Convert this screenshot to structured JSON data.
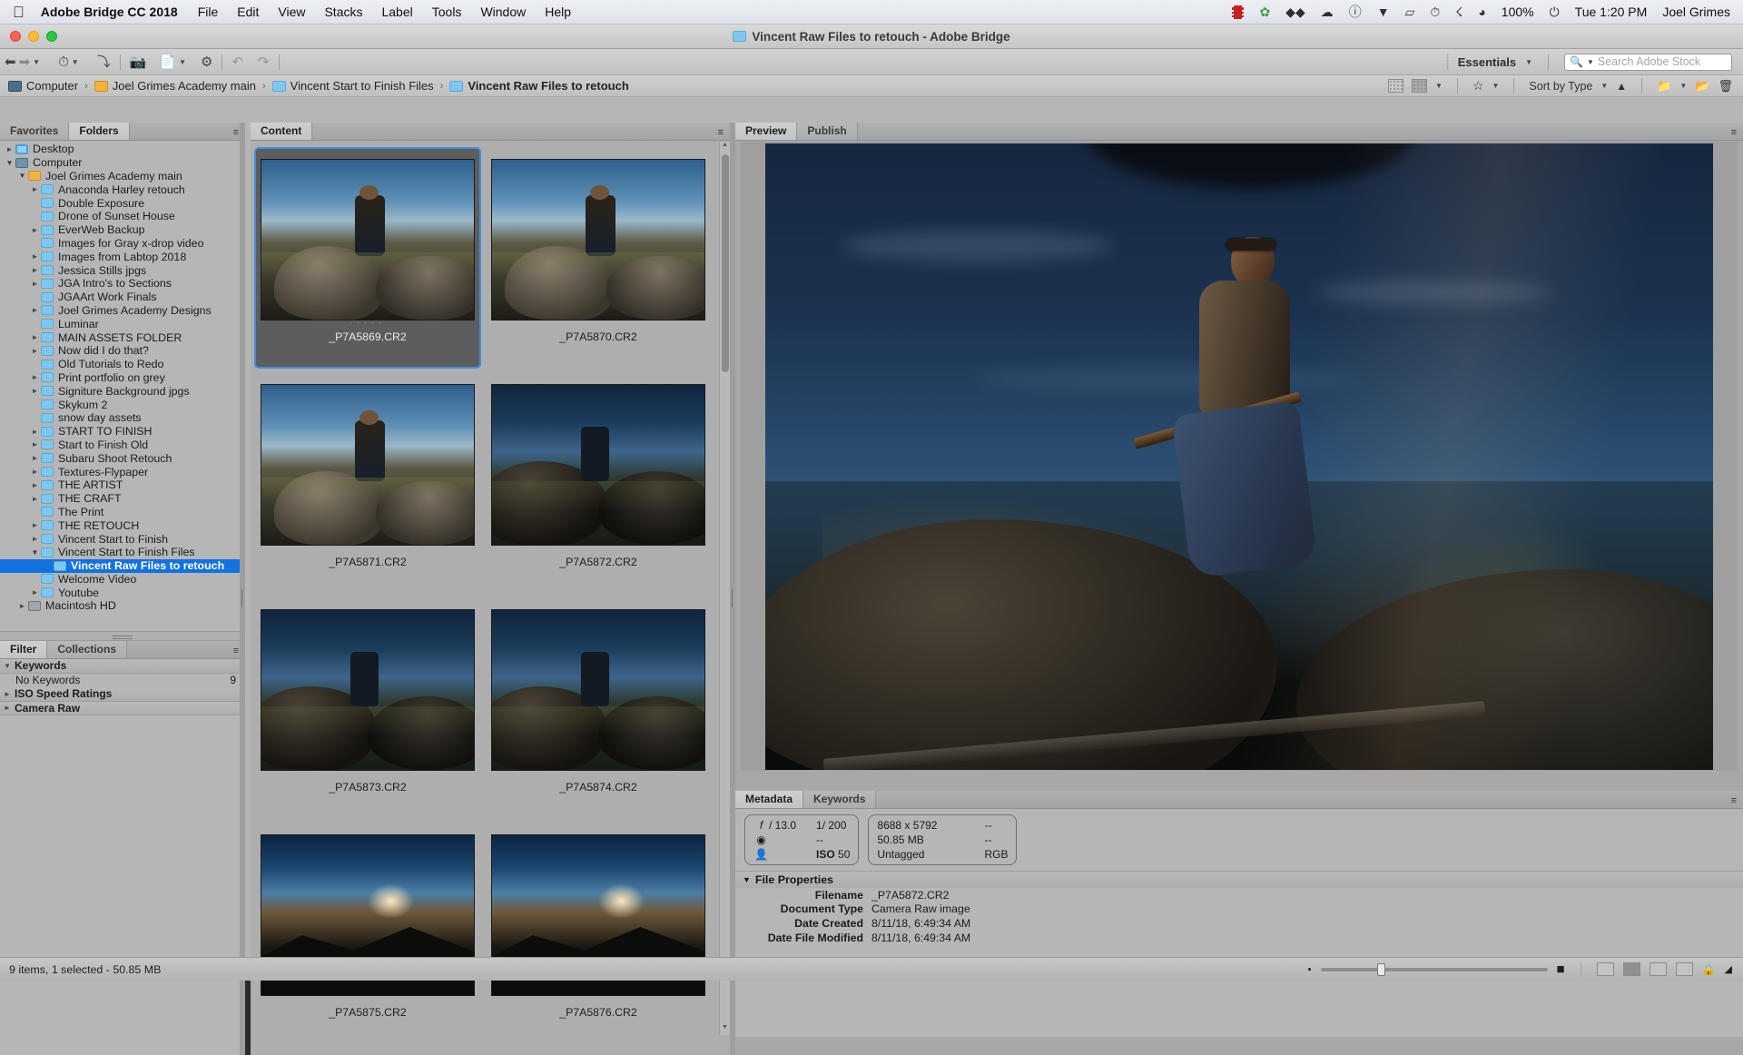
{
  "menubar": {
    "apple_icon": "apple-icon",
    "app_name": "Adobe Bridge CC 2018",
    "items": [
      "File",
      "Edit",
      "View",
      "Stacks",
      "Label",
      "Tools",
      "Window",
      "Help"
    ],
    "status_icons": [
      "filmstrip-icon",
      "leaf-icon",
      "dropbox-icon",
      "creative-cloud-icon",
      "info-icon",
      "airdrop-icon",
      "airplay-icon",
      "timemachine-icon",
      "bluetooth-icon",
      "wifi-icon"
    ],
    "battery_percent": "100%",
    "battery_icon": "battery-charging-icon",
    "clock": "Tue 1:20 PM",
    "user": "Joel Grimes"
  },
  "window": {
    "title": "Vincent Raw Files to retouch - Adobe Bridge",
    "title_icon": "folder-icon"
  },
  "toolbar": {
    "back_icon": "arrow-left-icon",
    "forward_icon": "arrow-right-icon",
    "history_dropdown_icon": "chevron-down-icon",
    "recent_icon": "clock-icon",
    "parent_icon": "go-up-icon",
    "boomerang_icon": "reveal-icon",
    "camera_import_icon": "get-photos-from-camera-icon",
    "refine_icon": "refine-icon",
    "rotate_icon": "rotate-icon",
    "rotate_ccw_icon": "rotate-counter-clockwise-icon",
    "rotate_cw_icon": "rotate-clockwise-icon",
    "workspace": "Essentials",
    "workspace_caret_icon": "chevron-down-icon",
    "search_placeholder": "Search Adobe Stock",
    "search_value": "",
    "search_icon": "search-icon"
  },
  "breadcrumb": {
    "separator": "›",
    "items": [
      {
        "label": "Computer",
        "icon": "computer-icon",
        "current": false
      },
      {
        "label": "Joel Grimes Academy main",
        "icon": "drive-icon",
        "current": false
      },
      {
        "label": "Vincent Start to Finish Files",
        "icon": "folder-icon",
        "current": false
      },
      {
        "label": "Vincent Raw Files to retouch",
        "icon": "folder-icon",
        "current": true
      }
    ],
    "right_tools": {
      "thumbnail_view_icon": "thumbnail-view-icon",
      "filter_view_icon": "filter-view-icon",
      "view_caret_icon": "chevron-down-icon",
      "star_icon": "star-rating-icon",
      "star_caret_icon": "chevron-down-icon",
      "sort_label": "Sort by Type",
      "sort_caret_icon": "chevron-down-icon",
      "sort_direction_icon": "sort-ascending-icon",
      "open_folder_icon": "open-in-icon",
      "open_caret_icon": "chevron-down-icon",
      "new_folder_icon": "new-folder-icon",
      "delete_icon": "trash-icon"
    }
  },
  "left_panel": {
    "tabs": [
      {
        "label": "Favorites",
        "active": false
      },
      {
        "label": "Folders",
        "active": true
      }
    ],
    "menu_icon": "panel-menu-icon",
    "tree": [
      {
        "label": "Desktop",
        "depth": 0,
        "twisty": "collapsed",
        "icon": "folder-icon",
        "selected": false
      },
      {
        "label": "Computer",
        "depth": 0,
        "twisty": "expanded",
        "icon": "computer-icon",
        "selected": false
      },
      {
        "label": "Joel Grimes Academy main",
        "depth": 1,
        "twisty": "expanded",
        "icon": "drive-icon",
        "selected": false
      },
      {
        "label": "Anaconda Harley retouch",
        "depth": 2,
        "twisty": "collapsed",
        "icon": "folder-icon",
        "selected": false
      },
      {
        "label": "Double Exposure",
        "depth": 2,
        "twisty": "none",
        "icon": "folder-icon",
        "selected": false
      },
      {
        "label": "Drone of Sunset House",
        "depth": 2,
        "twisty": "none",
        "icon": "folder-icon",
        "selected": false
      },
      {
        "label": "EverWeb Backup",
        "depth": 2,
        "twisty": "collapsed",
        "icon": "folder-icon",
        "selected": false
      },
      {
        "label": "Images for Gray x-drop video",
        "depth": 2,
        "twisty": "none",
        "icon": "folder-icon",
        "selected": false
      },
      {
        "label": "Images from Labtop 2018",
        "depth": 2,
        "twisty": "collapsed",
        "icon": "folder-icon",
        "selected": false
      },
      {
        "label": "Jessica Stills jpgs",
        "depth": 2,
        "twisty": "collapsed",
        "icon": "folder-icon",
        "selected": false
      },
      {
        "label": "JGA Intro's to Sections",
        "depth": 2,
        "twisty": "collapsed",
        "icon": "folder-icon",
        "selected": false
      },
      {
        "label": "JGAArt Work Finals",
        "depth": 2,
        "twisty": "none",
        "icon": "folder-icon",
        "selected": false
      },
      {
        "label": "Joel Grimes Academy Designs",
        "depth": 2,
        "twisty": "collapsed",
        "icon": "folder-icon",
        "selected": false
      },
      {
        "label": "Luminar",
        "depth": 2,
        "twisty": "none",
        "icon": "folder-icon",
        "selected": false
      },
      {
        "label": "MAIN ASSETS FOLDER",
        "depth": 2,
        "twisty": "collapsed",
        "icon": "folder-icon",
        "selected": false
      },
      {
        "label": "Now did I do that?",
        "depth": 2,
        "twisty": "collapsed",
        "icon": "folder-icon",
        "selected": false
      },
      {
        "label": "Old Tutorials to Redo",
        "depth": 2,
        "twisty": "none",
        "icon": "folder-icon",
        "selected": false
      },
      {
        "label": "Print portfolio on grey",
        "depth": 2,
        "twisty": "collapsed",
        "icon": "folder-icon",
        "selected": false
      },
      {
        "label": "Signiture Background jpgs",
        "depth": 2,
        "twisty": "collapsed",
        "icon": "folder-icon",
        "selected": false
      },
      {
        "label": "Skykum 2",
        "depth": 2,
        "twisty": "none",
        "icon": "folder-icon",
        "selected": false
      },
      {
        "label": "snow day assets",
        "depth": 2,
        "twisty": "none",
        "icon": "folder-icon",
        "selected": false
      },
      {
        "label": "START TO FINISH",
        "depth": 2,
        "twisty": "collapsed",
        "icon": "folder-icon",
        "selected": false
      },
      {
        "label": "Start to Finish Old",
        "depth": 2,
        "twisty": "collapsed",
        "icon": "folder-icon",
        "selected": false
      },
      {
        "label": "Subaru Shoot Retouch",
        "depth": 2,
        "twisty": "collapsed",
        "icon": "folder-icon",
        "selected": false
      },
      {
        "label": "Textures-Flypaper",
        "depth": 2,
        "twisty": "collapsed",
        "icon": "folder-icon",
        "selected": false
      },
      {
        "label": "THE ARTIST",
        "depth": 2,
        "twisty": "collapsed",
        "icon": "folder-icon",
        "selected": false
      },
      {
        "label": "THE CRAFT",
        "depth": 2,
        "twisty": "collapsed",
        "icon": "folder-icon",
        "selected": false
      },
      {
        "label": "The Print",
        "depth": 2,
        "twisty": "none",
        "icon": "folder-icon",
        "selected": false
      },
      {
        "label": "THE RETOUCH",
        "depth": 2,
        "twisty": "collapsed",
        "icon": "folder-icon",
        "selected": false
      },
      {
        "label": "Vincent Start to Finish",
        "depth": 2,
        "twisty": "collapsed",
        "icon": "folder-icon",
        "selected": false
      },
      {
        "label": "Vincent Start to Finish Files",
        "depth": 2,
        "twisty": "expanded",
        "icon": "folder-icon",
        "selected": false
      },
      {
        "label": "Vincent Raw Files to retouch",
        "depth": 3,
        "twisty": "none",
        "icon": "folder-icon",
        "selected": true
      },
      {
        "label": "Welcome Video",
        "depth": 2,
        "twisty": "none",
        "icon": "folder-icon",
        "selected": false
      },
      {
        "label": "Youtube",
        "depth": 2,
        "twisty": "collapsed",
        "icon": "folder-icon",
        "selected": false
      },
      {
        "label": "Macintosh HD",
        "depth": 1,
        "twisty": "collapsed",
        "icon": "harddrive-icon",
        "selected": false
      }
    ]
  },
  "filter_panel": {
    "tabs": [
      {
        "label": "Filter",
        "active": true
      },
      {
        "label": "Collections",
        "active": false
      }
    ],
    "menu_icon": "panel-menu-icon",
    "groups": [
      {
        "label": "Keywords",
        "expanded": true,
        "rows": [
          {
            "label": "No Keywords",
            "count": "9"
          }
        ]
      },
      {
        "label": "ISO Speed Ratings",
        "expanded": false,
        "rows": []
      },
      {
        "label": "Camera Raw",
        "expanded": false,
        "rows": []
      }
    ]
  },
  "content_panel": {
    "tabs": [
      {
        "label": "Content",
        "active": true
      }
    ],
    "menu_icon": "panel-menu-icon",
    "items": [
      {
        "name": "_P7A5869.CR2",
        "selected": true,
        "scene": "rocks-day",
        "has_dots": true
      },
      {
        "name": "_P7A5870.CR2",
        "selected": false,
        "scene": "rocks-day",
        "has_dots": false
      },
      {
        "name": "_P7A5871.CR2",
        "selected": false,
        "scene": "rocks-day",
        "has_dots": false
      },
      {
        "name": "_P7A5872.CR2",
        "selected": false,
        "scene": "rocks-dusk",
        "has_dots": false
      },
      {
        "name": "_P7A5873.CR2",
        "selected": false,
        "scene": "rocks-dusk",
        "has_dots": false
      },
      {
        "name": "_P7A5874.CR2",
        "selected": false,
        "scene": "rocks-dusk",
        "has_dots": false
      },
      {
        "name": "_P7A5875.CR2",
        "selected": false,
        "scene": "hill-sunset",
        "has_dots": false
      },
      {
        "name": "_P7A5876.CR2",
        "selected": false,
        "scene": "hill-sunset",
        "has_dots": false
      }
    ]
  },
  "preview_panel": {
    "tabs": [
      {
        "label": "Preview",
        "active": true
      },
      {
        "label": "Publish",
        "active": false
      }
    ],
    "menu_icon": "panel-menu-icon"
  },
  "metadata_panel": {
    "tabs": [
      {
        "label": "Metadata",
        "active": true
      },
      {
        "label": "Keywords",
        "active": false
      }
    ],
    "menu_icon": "panel-menu-icon",
    "summary_left": {
      "aperture_icon": "aperture-icon",
      "aperture": "/ 13.0",
      "shutter": "1/ 200",
      "metering_icon": "metering-mode-icon",
      "metering": "--",
      "whitebalance_icon": "white-balance-icon",
      "iso_label": "ISO",
      "iso": "50"
    },
    "summary_right": {
      "dimensions": "8688 x 5792",
      "dash1": "--",
      "filesize": "50.85 MB",
      "dash2": "--",
      "colorprofile": "Untagged",
      "colormode": "RGB"
    },
    "section_title": "File Properties",
    "section_expanded": true,
    "rows": [
      {
        "label": "Filename",
        "value": "_P7A5872.CR2"
      },
      {
        "label": "Document Type",
        "value": "Camera Raw image"
      },
      {
        "label": "Date Created",
        "value": "8/11/18, 6:49:34 AM"
      },
      {
        "label": "Date File Modified",
        "value": "8/11/18, 6:49:34 AM"
      }
    ]
  },
  "statusbar": {
    "left_text": "9 items, 1 selected - 50.85 MB",
    "zoom_minus_icon": "zoom-out-icon",
    "zoom_plus_icon": "zoom-in-icon",
    "view_modes": [
      {
        "icon": "grid-view-icon",
        "active": false
      },
      {
        "icon": "details-view-icon",
        "active": true
      },
      {
        "icon": "list-view-icon",
        "active": false
      },
      {
        "icon": "compact-view-icon",
        "active": false
      }
    ],
    "lock_icon": "lock-icon",
    "resize_icon": "resize-grip-icon"
  },
  "colors": {
    "selection_blue": "#1272e0",
    "panel_gray": "#b6b6b6",
    "content_gray": "#aeaeae",
    "folder_blue": "#7ec8f0",
    "drive_orange": "#f2b23e"
  }
}
